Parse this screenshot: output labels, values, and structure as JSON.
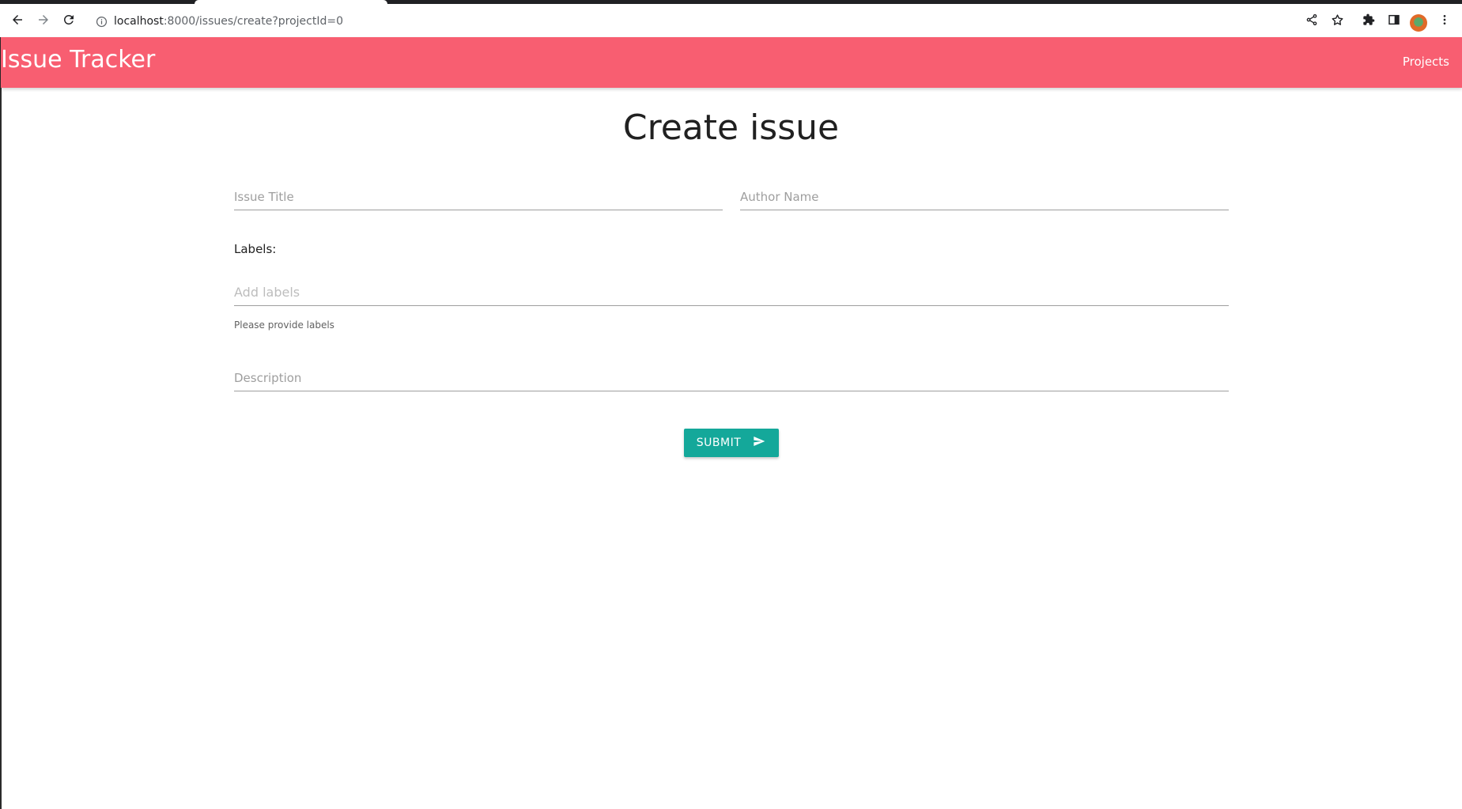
{
  "browser": {
    "url_host": "localhost",
    "url_rest": ":8000/issues/create?projectId=0"
  },
  "app": {
    "brand": "Issue Tracker",
    "nav_projects": "Projects",
    "colors": {
      "appbar": "#f85e71",
      "submit": "#14a89a"
    }
  },
  "form": {
    "title": "Create issue",
    "issue_title": {
      "placeholder": "Issue Title",
      "value": ""
    },
    "author_name": {
      "placeholder": "Author Name",
      "value": ""
    },
    "labels_heading": "Labels:",
    "labels_input": {
      "placeholder": "Add labels",
      "value": ""
    },
    "labels_helper": "Please provide labels",
    "description": {
      "placeholder": "Description",
      "value": ""
    },
    "submit_label": "SUBMIT"
  },
  "icons": {
    "back": "back-arrow-icon",
    "forward": "forward-arrow-icon",
    "reload": "reload-icon",
    "info": "info-icon",
    "share": "share-icon",
    "bookmark": "star-icon",
    "extensions": "puzzle-icon",
    "side_panel": "side-panel-icon",
    "menu": "kebab-menu-icon",
    "submit": "send-icon"
  }
}
